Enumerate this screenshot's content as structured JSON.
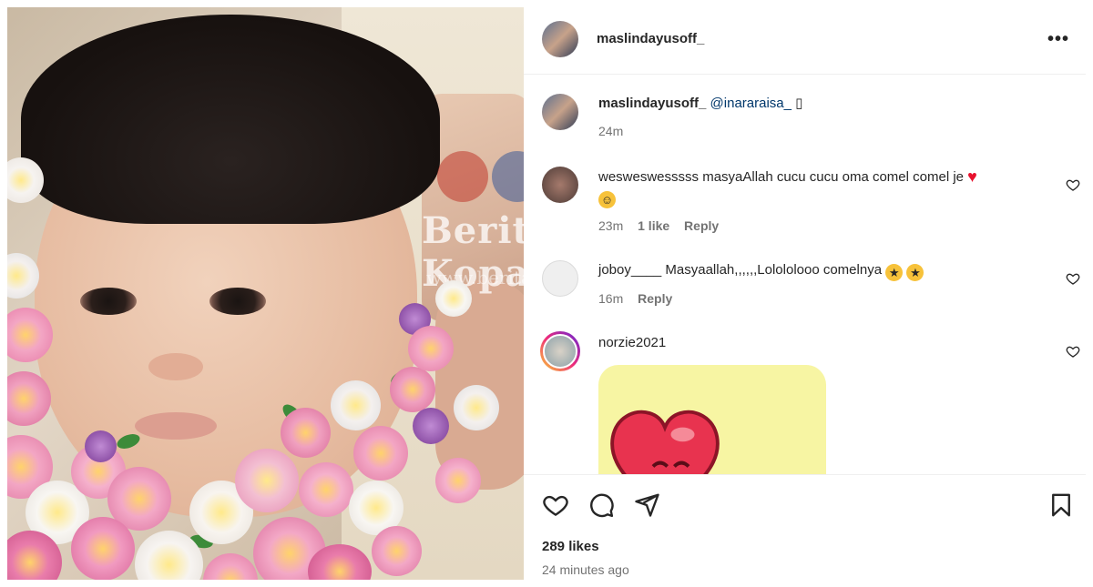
{
  "post": {
    "author": "maslindayusoff_",
    "photo_watermark": {
      "brand": "Berita Kopak",
      "url": "www.beritakopak"
    }
  },
  "header": {
    "username": "maslindayusoff_",
    "more_label": "•••"
  },
  "caption": {
    "username": "maslindayusoff_",
    "mention": "@inararaisa_",
    "trailing": "▯",
    "time": "24m"
  },
  "comments": [
    {
      "username": "wesweswesssss",
      "text": "masyaAllah cucu cucu oma comel comel je",
      "time": "23m",
      "likes": "1 like",
      "reply": "Reply"
    },
    {
      "username": "joboy____",
      "text": "Masyaallah,,,,,,Lolololooo comelnya",
      "time": "16m",
      "reply": "Reply"
    },
    {
      "username": "norzie2021",
      "text": ""
    }
  ],
  "actions": {
    "icons": [
      "heart-icon",
      "comment-icon",
      "share-icon",
      "bookmark-icon"
    ]
  },
  "likes": "289 likes",
  "posted": "24 minutes ago",
  "colors": {
    "link": "#00376b",
    "muted": "#737373",
    "heart": "#e8112d",
    "sticker_bg": "#f7f5a3"
  }
}
